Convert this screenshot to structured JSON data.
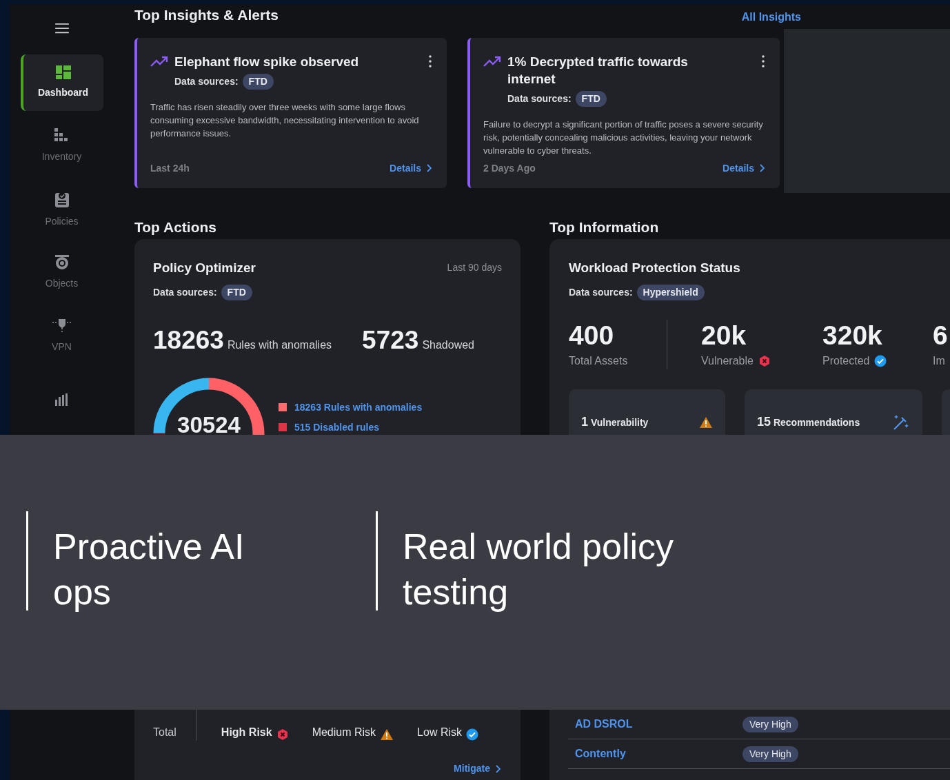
{
  "sidebar": {
    "items": [
      {
        "label": "Dashboard",
        "selected": true
      },
      {
        "label": "Inventory",
        "selected": false
      },
      {
        "label": "Policies",
        "selected": false
      },
      {
        "label": "Objects",
        "selected": false
      },
      {
        "label": "VPN",
        "selected": false
      },
      {
        "selected": false
      }
    ]
  },
  "insights": {
    "title": "Top Insights & Alerts",
    "link": "All Insights",
    "cards": [
      {
        "title": "Elephant flow spike observed",
        "sources_label": "Data sources:",
        "sources": [
          "FTD"
        ],
        "body": "Traffic has risen steadily over three weeks with some large flows consuming excessive bandwidth, necessitating intervention to avoid performance issues.",
        "time": "Last 24h",
        "link": "Details"
      },
      {
        "title": "1% Decrypted traffic towards internet",
        "sources_label": "Data sources:",
        "sources": [
          "FTD"
        ],
        "body": "Failure to decrypt a significant portion of traffic poses a severe security risk, potentially concealing malicious activities, leaving your network vulnerable to cyber threats.",
        "time": "2 Days Ago",
        "link": "Details"
      }
    ]
  },
  "top_actions": {
    "title": "Top Actions",
    "policy_optimizer": {
      "title": "Policy Optimizer",
      "period": "Last 90 days",
      "sources_label": "Data sources:",
      "sources": [
        "FTD"
      ],
      "stats": [
        {
          "value": "18263",
          "label": "Rules with anomalies"
        },
        {
          "value": "5723",
          "label": "Shadowed"
        }
      ],
      "donut_center": "30524",
      "legend": [
        {
          "label": "18263 Rules with anomalies",
          "color": "#ff6b6e"
        },
        {
          "label": "515 Disabled rules",
          "color": "#dc3545"
        }
      ],
      "risks": [
        {
          "label": "Total",
          "kind": "plain"
        },
        {
          "label": "High Risk",
          "kind": "high"
        },
        {
          "label": "Medium Risk",
          "kind": "medium"
        },
        {
          "label": "Low Risk",
          "kind": "low"
        }
      ],
      "link": "Mitigate"
    }
  },
  "top_information": {
    "title": "Top Information",
    "workload": {
      "title": "Workload Protection Status",
      "sources_label": "Data sources:",
      "sources": [
        "Hypershield"
      ],
      "stats": [
        {
          "value": "400",
          "label": "Total Assets",
          "kind": "plain"
        },
        {
          "value": "20k",
          "label": "Vulnerable",
          "kind": "vulnerable"
        },
        {
          "value": "320k",
          "label": "Protected",
          "kind": "protected"
        },
        {
          "value": "6",
          "label": "Im",
          "kind": "plain"
        }
      ],
      "tiles": [
        {
          "count": "1",
          "label": "Vulnerability",
          "kind": "warning"
        },
        {
          "count": "15",
          "label": "Recommendations",
          "kind": "magic"
        }
      ],
      "rows": [
        {
          "name": "AD DSROL",
          "badge": "Very High"
        },
        {
          "name": "Contently",
          "badge": "Very High"
        }
      ]
    }
  },
  "banner": {
    "captions": [
      "Proactive AI ops",
      "Real world policy testing"
    ]
  }
}
